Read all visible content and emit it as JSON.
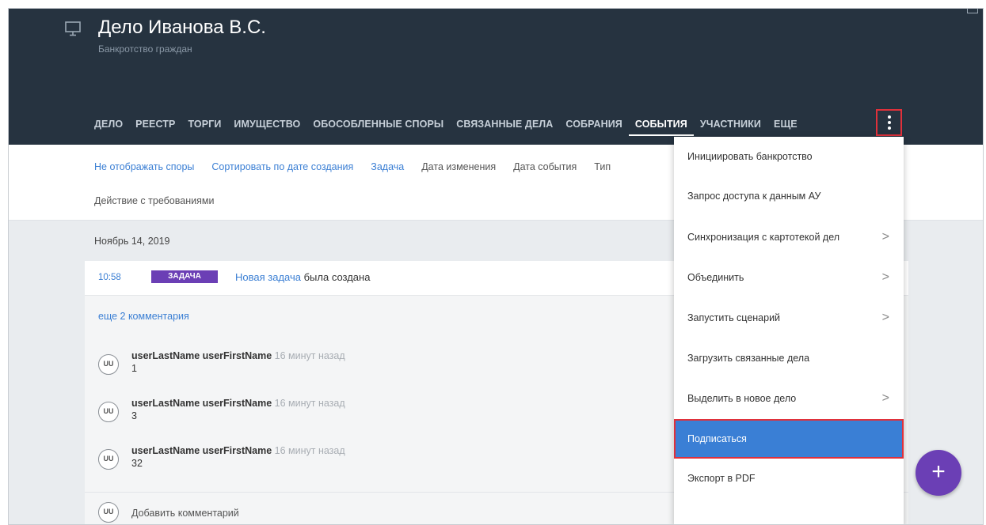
{
  "header": {
    "title": "Дело Иванова В.С.",
    "subtitle": "Банкротство граждан"
  },
  "tabs": [
    {
      "label": "ДЕЛО"
    },
    {
      "label": "РЕЕСТР"
    },
    {
      "label": "ТОРГИ"
    },
    {
      "label": "ИМУЩЕСТВО"
    },
    {
      "label": "ОБОСОБЛЕННЫЕ СПОРЫ"
    },
    {
      "label": "СВЯЗАННЫЕ ДЕЛА"
    },
    {
      "label": "СОБРАНИЯ"
    },
    {
      "label": "СОБЫТИЯ",
      "active": true
    },
    {
      "label": "УЧАСТНИКИ"
    },
    {
      "label": "ЕЩЕ"
    }
  ],
  "filters": {
    "items": [
      "Не отображать споры",
      "Сортировать по дате создания",
      "Задача",
      "Дата изменения",
      "Дата события",
      "Тип"
    ],
    "second_row": "Действие с требованиями"
  },
  "feed": {
    "date_heading": "Ноябрь 14, 2019",
    "event": {
      "time": "10:58",
      "badge": "ЗАДАЧА",
      "link": "Новая задача",
      "text": " была создана"
    },
    "more_comments": "еще 2 комментария",
    "comments": [
      {
        "avatar": "UU",
        "author": "userLastName userFirstName",
        "time": " 16 минут назад",
        "text": "1"
      },
      {
        "avatar": "UU",
        "author": "userLastName userFirstName",
        "time": " 16 минут назад",
        "text": "3"
      },
      {
        "avatar": "UU",
        "author": "userLastName userFirstName",
        "time": " 16 минут назад",
        "text": "32"
      }
    ],
    "add_comment": {
      "avatar": "UU",
      "label": "Добавить комментарий"
    }
  },
  "menu": {
    "items": [
      {
        "label": "Инициировать банкротство",
        "submenu": false
      },
      {
        "label": "Запрос доступа к данным АУ",
        "submenu": false
      },
      {
        "label": "Синхронизация с картотекой дел",
        "submenu": true
      },
      {
        "label": "Объединить",
        "submenu": true
      },
      {
        "label": "Запустить сценарий",
        "submenu": true
      },
      {
        "label": "Загрузить связанные дела",
        "submenu": false
      },
      {
        "label": "Выделить в новое дело",
        "submenu": true
      },
      {
        "label": "Подписаться",
        "submenu": false,
        "highlighted": true
      },
      {
        "label": "Экспорт в PDF",
        "submenu": false
      }
    ],
    "chevron": ">"
  },
  "fab": {
    "label": "+"
  },
  "colors": {
    "header_bg": "#263340",
    "accent_blue": "#3a7fd5",
    "badge_purple": "#6b3fb5",
    "highlight_red": "#e0313b"
  }
}
